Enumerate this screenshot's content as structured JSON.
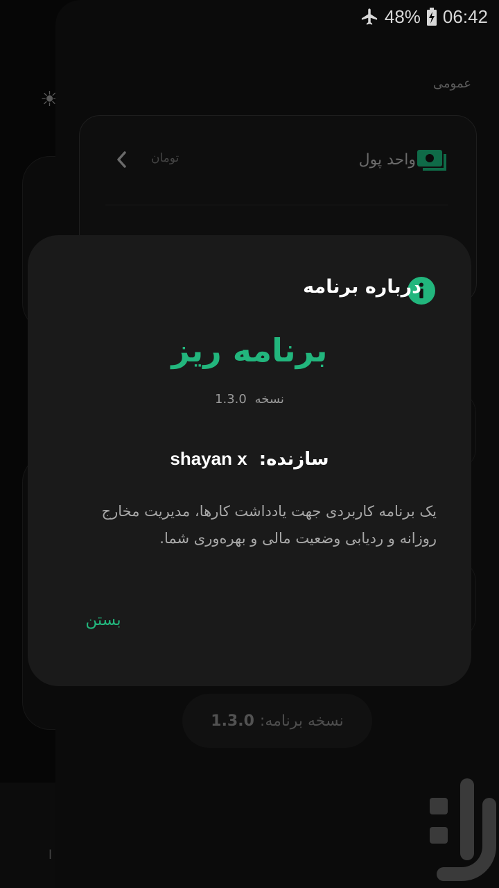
{
  "status_bar": {
    "battery_percent": "48%",
    "time": "06:42",
    "airplane_icon": "airplane-icon",
    "battery_icon": "battery-charging-icon"
  },
  "background": {
    "section_label": "عمومی",
    "currency_row": {
      "title": "واحد پول",
      "value": "تومان",
      "icon": "money-icon"
    },
    "version_pill": {
      "label": "نسخه برنامه:",
      "version": "1.3.0"
    },
    "side_text": "ا"
  },
  "dialog": {
    "title": "درباره برنامه",
    "title_icon": "info-icon",
    "app_name": "برنامه ریز",
    "version_prefix": "نسخه",
    "version": "1.3.0",
    "developer_label": "سازنده:",
    "developer_name": "shayan x",
    "description": "یک برنامه کاربردی جهت یادداشت کارها، مدیریت مخارج روزانه و ردیابی وضعیت مالی و بهره‌وری شما.",
    "close_label": "بستن"
  },
  "colors": {
    "accent": "#22b67d",
    "dialog_bg": "#1a1a1a",
    "page_bg": "#0b0b0b"
  }
}
